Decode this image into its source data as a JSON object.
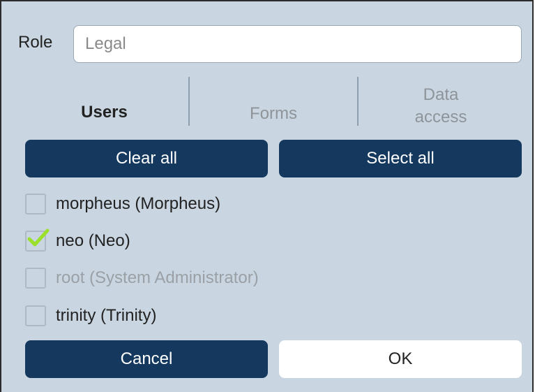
{
  "role": {
    "label": "Role",
    "value": "Legal"
  },
  "tabs": [
    {
      "label": "Users",
      "active": true
    },
    {
      "label": "Forms",
      "active": false
    },
    {
      "label": "Data\naccess",
      "active": false
    }
  ],
  "actions": {
    "clear_all": "Clear all",
    "select_all": "Select all"
  },
  "users": [
    {
      "label": "morpheus (Morpheus)",
      "checked": false,
      "disabled": false
    },
    {
      "label": "neo (Neo)",
      "checked": true,
      "disabled": false
    },
    {
      "label": "root (System Administrator)",
      "checked": false,
      "disabled": true
    },
    {
      "label": "trinity (Trinity)",
      "checked": false,
      "disabled": false
    }
  ],
  "footer": {
    "cancel": "Cancel",
    "ok": "OK"
  },
  "colors": {
    "background": "#c9d6e1",
    "primary_button": "#15395e",
    "checkmark": "#9be02a"
  }
}
